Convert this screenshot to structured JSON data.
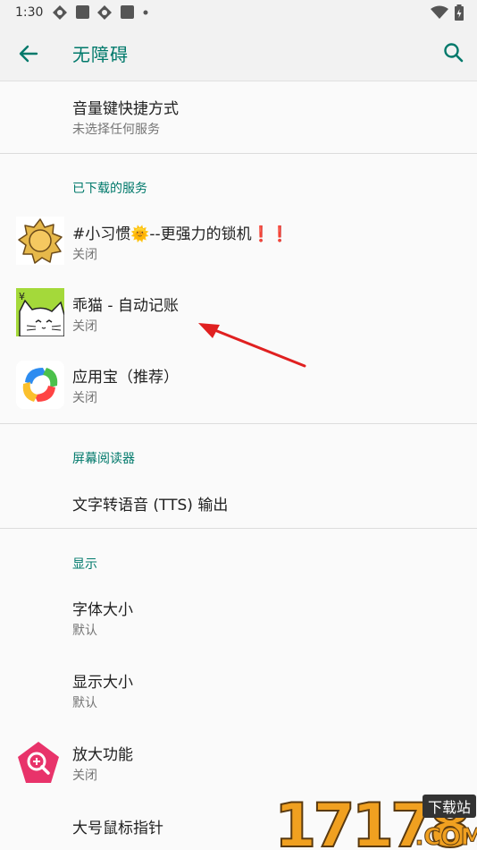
{
  "status": {
    "time": "1:30"
  },
  "header": {
    "title": "无障碍"
  },
  "top_item": {
    "title": "音量键快捷方式",
    "subtitle": "未选择任何服务"
  },
  "downloaded": {
    "label": "已下载的服务",
    "items": [
      {
        "title": "#小习惯🌞--更强力的锁机❗❗",
        "subtitle": "关闭"
      },
      {
        "title": "乖猫 - 自动记账",
        "subtitle": "关闭"
      },
      {
        "title": "应用宝（推荐）",
        "subtitle": "关闭"
      }
    ]
  },
  "reader": {
    "label": "屏幕阅读器",
    "items": [
      {
        "title": "文字转语音 (TTS) 输出"
      }
    ]
  },
  "display": {
    "label": "显示",
    "items": [
      {
        "title": "字体大小",
        "subtitle": "默认"
      },
      {
        "title": "显示大小",
        "subtitle": "默认"
      },
      {
        "title": "放大功能",
        "subtitle": "关闭"
      },
      {
        "title": "大号鼠标指针"
      }
    ]
  },
  "watermark": {
    "number": "17178",
    "tag": "下载站",
    "domain": ".COM"
  },
  "colors": {
    "accent": "#00796b",
    "arrow": "#e02020"
  },
  "icons": [
    "back-arrow-icon",
    "search-icon",
    "sun-icon",
    "cat-icon",
    "appbao-icon",
    "magnify-icon"
  ]
}
